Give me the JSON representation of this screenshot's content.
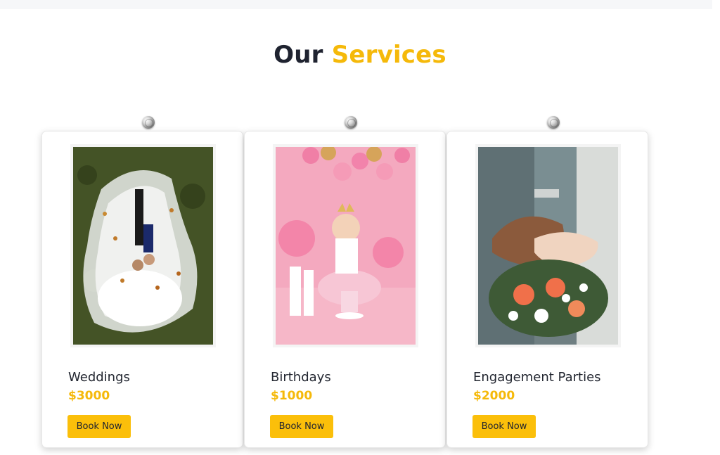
{
  "section": {
    "title_part1": "Our",
    "title_part2": "Services"
  },
  "services": [
    {
      "title": "Weddings",
      "price": "$3000",
      "button": "Book Now",
      "image": "wedding-couple-photo"
    },
    {
      "title": "Birthdays",
      "price": "$1000",
      "button": "Book Now",
      "image": "birthday-baby-photo"
    },
    {
      "title": "Engagement Parties",
      "price": "$2000",
      "button": "Book Now",
      "image": "engagement-hands-bouquet-photo"
    }
  ],
  "colors": {
    "accent": "#f5b90a",
    "button": "#fbbf0a",
    "text": "#1f2330"
  }
}
